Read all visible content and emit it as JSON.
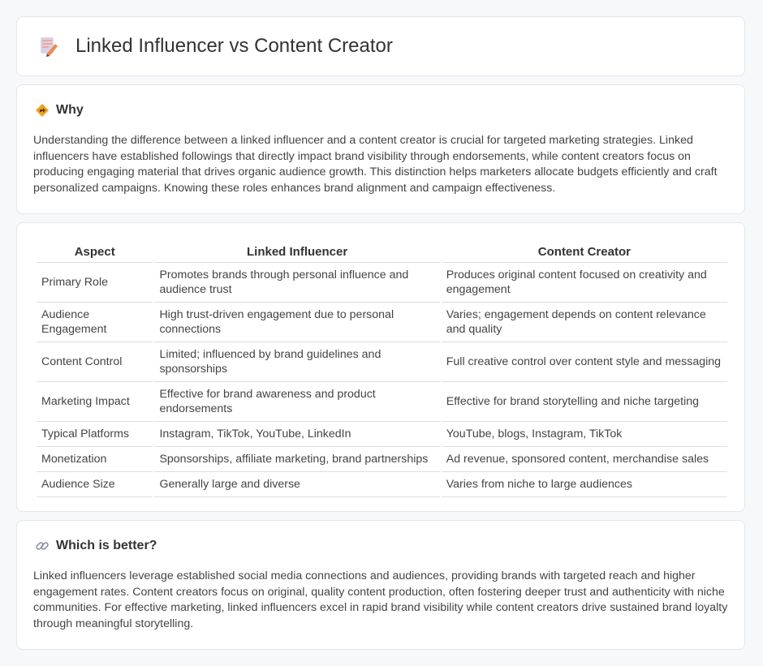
{
  "header": {
    "title": "Linked Influencer vs Content Creator",
    "icon": "document-pencil-icon"
  },
  "why": {
    "title": "Why",
    "icon": "diamond-direction-icon",
    "body": "Understanding the difference between a linked influencer and a content creator is crucial for targeted marketing strategies. Linked influencers have established followings that directly impact brand visibility through endorsements, while content creators focus on producing engaging material that drives organic audience growth. This distinction helps marketers allocate budgets efficiently and craft personalized campaigns. Knowing these roles enhances brand alignment and campaign effectiveness."
  },
  "table": {
    "headers": [
      "Aspect",
      "Linked Influencer",
      "Content Creator"
    ],
    "rows": [
      [
        "Primary Role",
        "Promotes brands through personal influence and audience trust",
        "Produces original content focused on creativity and engagement"
      ],
      [
        "Audience Engagement",
        "High trust-driven engagement due to personal connections",
        "Varies; engagement depends on content relevance and quality"
      ],
      [
        "Content Control",
        "Limited; influenced by brand guidelines and sponsorships",
        "Full creative control over content style and messaging"
      ],
      [
        "Marketing Impact",
        "Effective for brand awareness and product endorsements",
        "Effective for brand storytelling and niche targeting"
      ],
      [
        "Typical Platforms",
        "Instagram, TikTok, YouTube, LinkedIn",
        "YouTube, blogs, Instagram, TikTok"
      ],
      [
        "Monetization",
        "Sponsorships, affiliate marketing, brand partnerships",
        "Ad revenue, sponsored content, merchandise sales"
      ],
      [
        "Audience Size",
        "Generally large and diverse",
        "Varies from niche to large audiences"
      ]
    ]
  },
  "better": {
    "title": "Which is better?",
    "icon": "link-icon",
    "body": "Linked influencers leverage established social media connections and audiences, providing brands with targeted reach and higher engagement rates. Content creators focus on original, quality content production, often fostering deeper trust and authenticity with niche communities. For effective marketing, linked influencers excel in rapid brand visibility while content creators drive sustained brand loyalty through meaningful storytelling."
  },
  "colors": {
    "background": "#f7f8fa",
    "card": "#ffffff",
    "border": "#e3e6ea",
    "text": "#444444",
    "accent": "#f0a020"
  }
}
